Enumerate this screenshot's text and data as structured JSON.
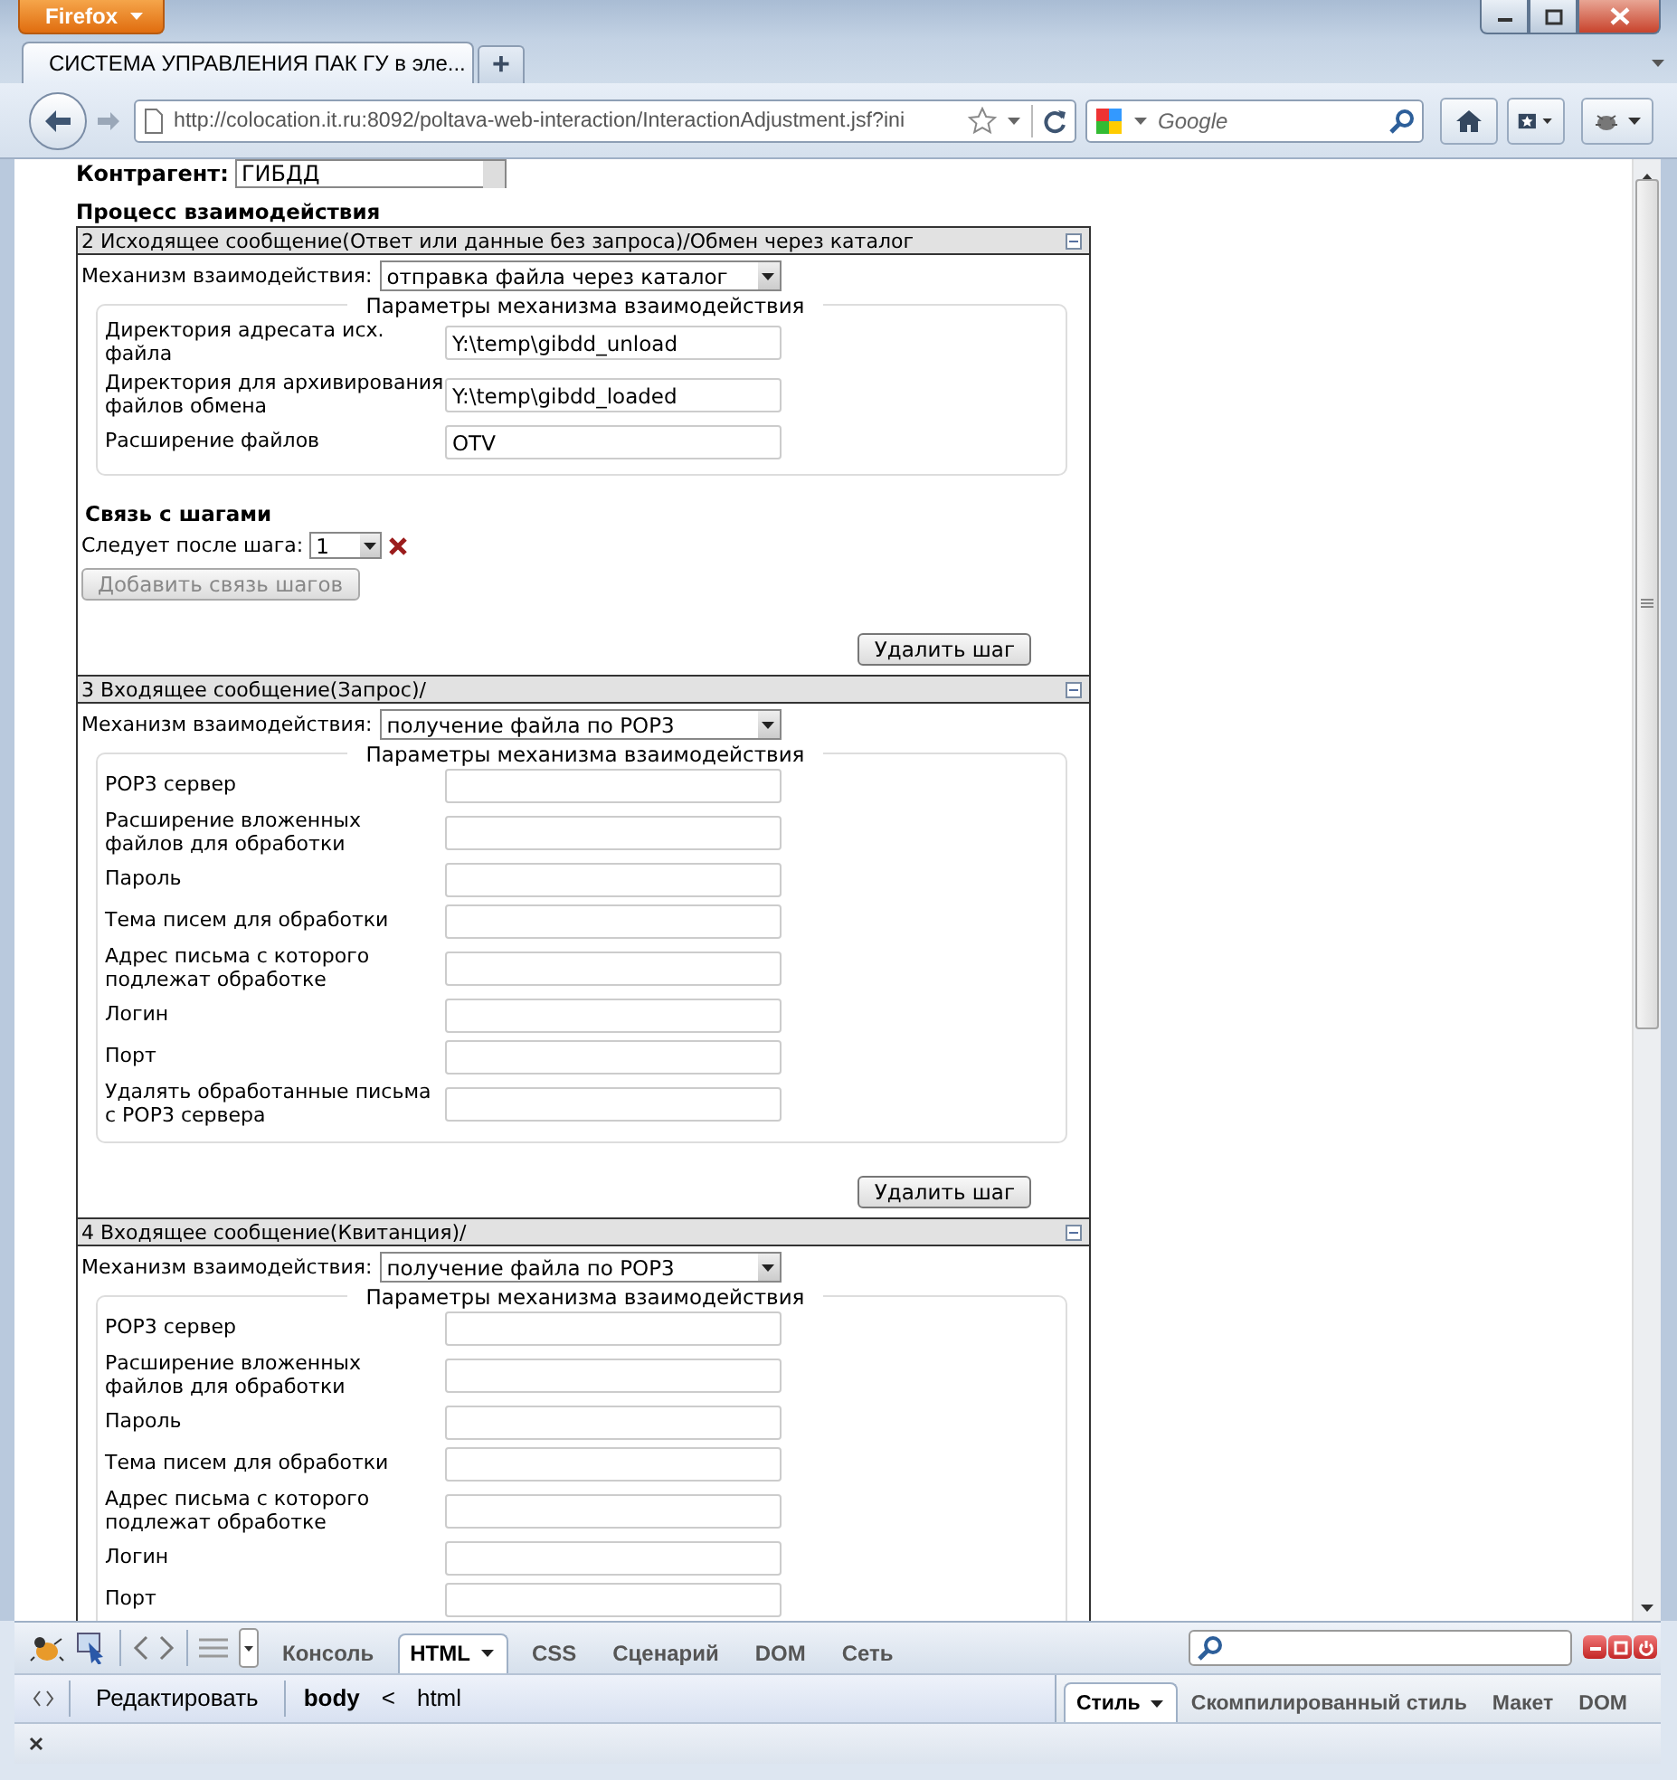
{
  "window": {
    "menu_button": "Firefox"
  },
  "tabs": [
    {
      "title": "СИСТЕМА УПРАВЛЕНИЯ ПАК ГУ в эле...",
      "selected": true
    }
  ],
  "new_tab_button": "+",
  "address_bar": {
    "url": "http://colocation.it.ru:8092/poltava-web-interaction/InteractionAdjustment.jsf?ini"
  },
  "search_bar": {
    "placeholder": "Google"
  },
  "page": {
    "counterparty_label": "Контрагент:",
    "counterparty_value": "ГИБДД",
    "process_title": "Процесс взаимодействия",
    "steps": [
      {
        "title": "2 Исходящее сообщение(Ответ или данные без запроса)/Обмен через каталог",
        "mechanism_label": "Механизм взаимодействия:",
        "mechanism_value": "отправка файла через каталог",
        "params_title": "Параметры механизма взаимодействия",
        "params": [
          {
            "label": "Директория адресата исх. файла",
            "value": "Y:\\temp\\gibdd_unload"
          },
          {
            "label": "Директория для архивирования файлов обмена",
            "value": "Y:\\temp\\gibdd_loaded"
          },
          {
            "label": "Расширение файлов",
            "value": "OTV"
          }
        ],
        "links": {
          "title": "Связь с шагами",
          "follows_label": "Следует после шага:",
          "follows_value": "1",
          "add_button": {
            "label": "Добавить связь шагов",
            "disabled": true
          }
        },
        "delete_button": "Удалить шаг"
      },
      {
        "title": "3 Входящее сообщение(Запрос)/",
        "mechanism_label": "Механизм взаимодействия:",
        "mechanism_value": "получение файла по POP3",
        "params_title": "Параметры механизма взаимодействия",
        "params": [
          {
            "label": "POP3 сервер"
          },
          {
            "label": "Расширение вложенных файлов для обработки"
          },
          {
            "label": "Пароль"
          },
          {
            "label": "Тема писем для обработки"
          },
          {
            "label": "Адрес письма с которого подлежат обработке"
          },
          {
            "label": "Логин"
          },
          {
            "label": "Порт"
          },
          {
            "label": "Удалять обработанные письма с POP3 сервера"
          }
        ],
        "delete_button": "Удалить шаг"
      },
      {
        "title": "4 Входящее сообщение(Квитанция)/",
        "mechanism_label": "Механизм взаимодействия:",
        "mechanism_value": "получение файла по POP3",
        "params_title": "Параметры механизма взаимодействия",
        "params": [
          {
            "label": "POP3 сервер"
          },
          {
            "label": "Расширение вложенных файлов для обработки"
          },
          {
            "label": "Пароль"
          },
          {
            "label": "Тема писем для обработки"
          },
          {
            "label": "Адрес письма с которого подлежат обработке"
          },
          {
            "label": "Логин"
          },
          {
            "label": "Порт"
          }
        ]
      }
    ]
  },
  "firebug": {
    "tabs": [
      {
        "label": "Консоль",
        "selected": false,
        "dropdown": false
      },
      {
        "label": "HTML",
        "selected": true,
        "dropdown": true
      },
      {
        "label": "CSS",
        "selected": false,
        "dropdown": false
      },
      {
        "label": "Сценарий",
        "selected": false,
        "dropdown": false
      },
      {
        "label": "DOM",
        "selected": false,
        "dropdown": false
      },
      {
        "label": "Сеть",
        "selected": false,
        "dropdown": false
      }
    ],
    "edit_button": "Редактировать",
    "breadcrumb": [
      {
        "label": "body",
        "selected": true
      },
      {
        "label": "html",
        "selected": false
      }
    ],
    "breadcrumb_separator": "<",
    "side_tabs": [
      {
        "label": "Стиль",
        "selected": true,
        "dropdown": true
      },
      {
        "label": "Скомпилированный стиль",
        "selected": false,
        "dropdown": false
      },
      {
        "label": "Макет",
        "selected": false,
        "dropdown": false
      },
      {
        "label": "DOM",
        "selected": false,
        "dropdown": false
      }
    ]
  }
}
